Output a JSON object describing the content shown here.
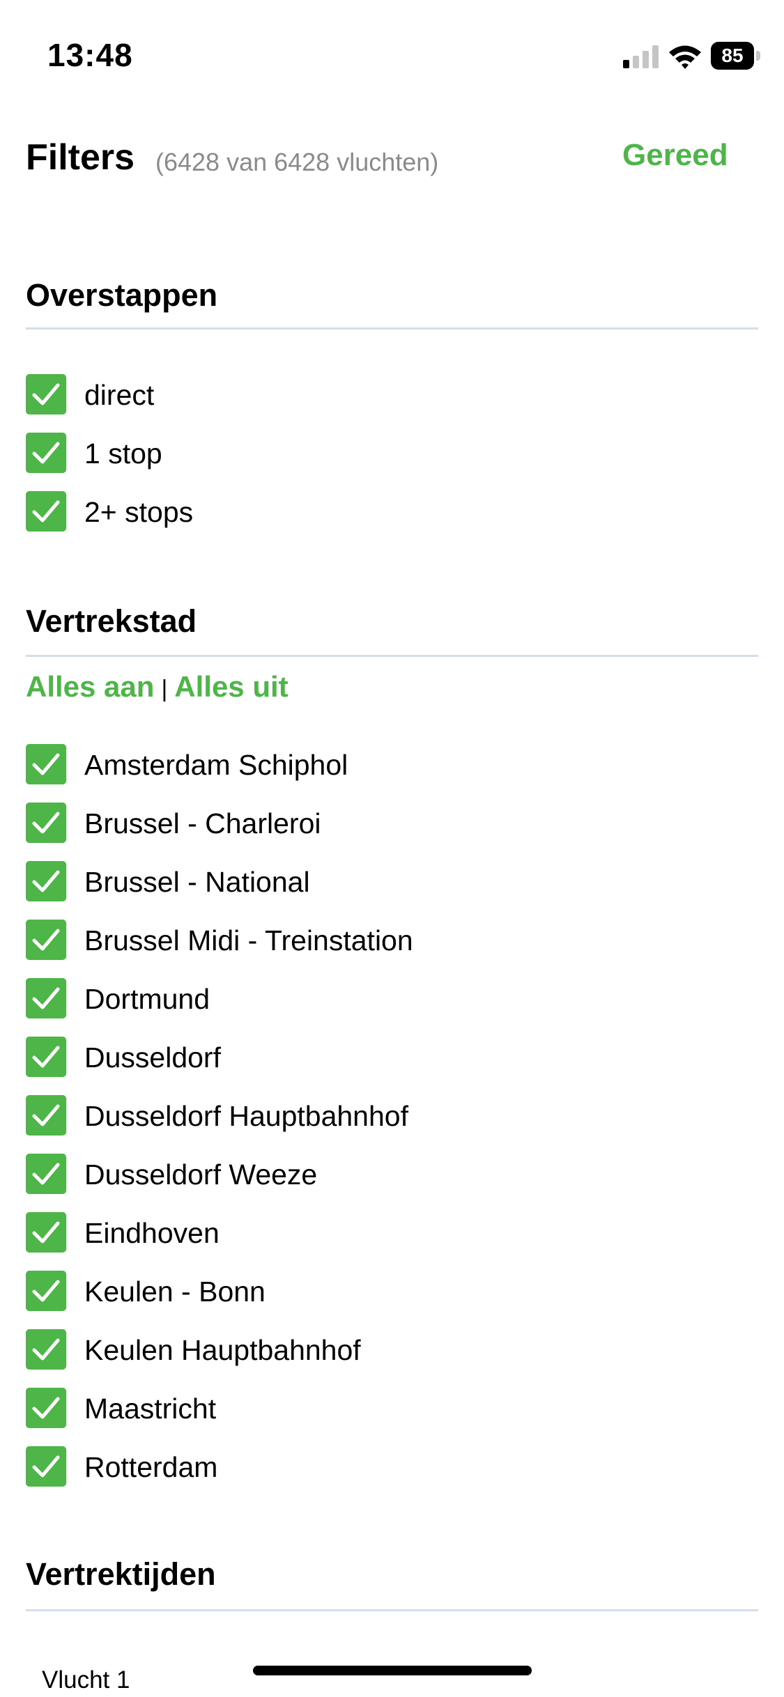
{
  "status_bar": {
    "time": "13:48",
    "battery": "85"
  },
  "header": {
    "title": "Filters",
    "count": "(6428 van 6428 vluchten)",
    "done_label": "Gereed"
  },
  "stops": {
    "title": "Overstappen",
    "items": [
      {
        "label": "direct",
        "checked": true
      },
      {
        "label": "1 stop",
        "checked": true
      },
      {
        "label": "2+ stops",
        "checked": true
      }
    ]
  },
  "departure_city": {
    "title": "Vertrekstad",
    "all_on": "Alles aan",
    "separator": "|",
    "all_off": "Alles uit",
    "items": [
      {
        "label": "Amsterdam Schiphol",
        "checked": true
      },
      {
        "label": "Brussel - Charleroi",
        "checked": true
      },
      {
        "label": "Brussel - National",
        "checked": true
      },
      {
        "label": "Brussel Midi - Treinstation",
        "checked": true
      },
      {
        "label": "Dortmund",
        "checked": true
      },
      {
        "label": "Dusseldorf",
        "checked": true
      },
      {
        "label": "Dusseldorf Hauptbahnhof",
        "checked": true
      },
      {
        "label": "Dusseldorf Weeze",
        "checked": true
      },
      {
        "label": "Eindhoven",
        "checked": true
      },
      {
        "label": "Keulen - Bonn",
        "checked": true
      },
      {
        "label": "Keulen Hauptbahnhof",
        "checked": true
      },
      {
        "label": "Maastricht",
        "checked": true
      },
      {
        "label": "Rotterdam",
        "checked": true
      }
    ]
  },
  "departure_times": {
    "title": "Vertrektijden",
    "flight_label": "Vlucht 1"
  },
  "colors": {
    "accent": "#4eb548",
    "divider": "#d3deec",
    "muted": "#8a8a8a"
  }
}
